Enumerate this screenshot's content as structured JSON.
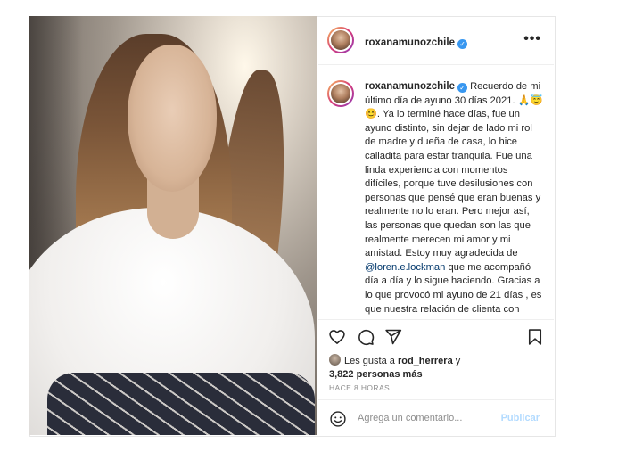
{
  "post": {
    "username": "roxanamunozchile",
    "verified_glyph": "✓",
    "more_icon": "more-options-icon",
    "caption_text": "Recuerdo de mi último día de ayuno 30 días 2021. 🙏😇😊. Ya lo terminé hace días, fue un ayuno distinto, sin dejar de lado mi rol de madre y dueña de casa, lo hice calladita para estar tranquila. Fue una linda experiencia con momentos difíciles, porque tuve desilusiones con personas que pensé que eran buenas y realmente no lo eran. Pero mejor así, las personas que quedan son las que realmente merecen mi amor y mi amistad. Estoy muy agradecida de ",
    "mention": "@loren.e.lockman",
    "caption_text_2": " que me acompañó día a día y lo sigue haciendo. Gracias a lo que provocó mi ayuno de 21 días , es que nuestra relación de clienta con Loren se transformó en una hermosa amistad. Estoy enormemente",
    "likes_prefix": "Les gusta a ",
    "liked_by": "rod_herrera",
    "likes_and": " y",
    "likes_count": "3,822 personas más",
    "time_ago": "HACE 8 HORAS",
    "comment_placeholder": "Agrega un comentario...",
    "publish_label": "Publicar"
  },
  "icons": [
    "heart-icon",
    "comment-icon",
    "share-icon",
    "bookmark-icon",
    "smile-icon"
  ],
  "colors": {
    "link": "#00376b",
    "verified": "#3897f0",
    "publish": "#b3dbff",
    "muted": "#8e8e8e"
  }
}
